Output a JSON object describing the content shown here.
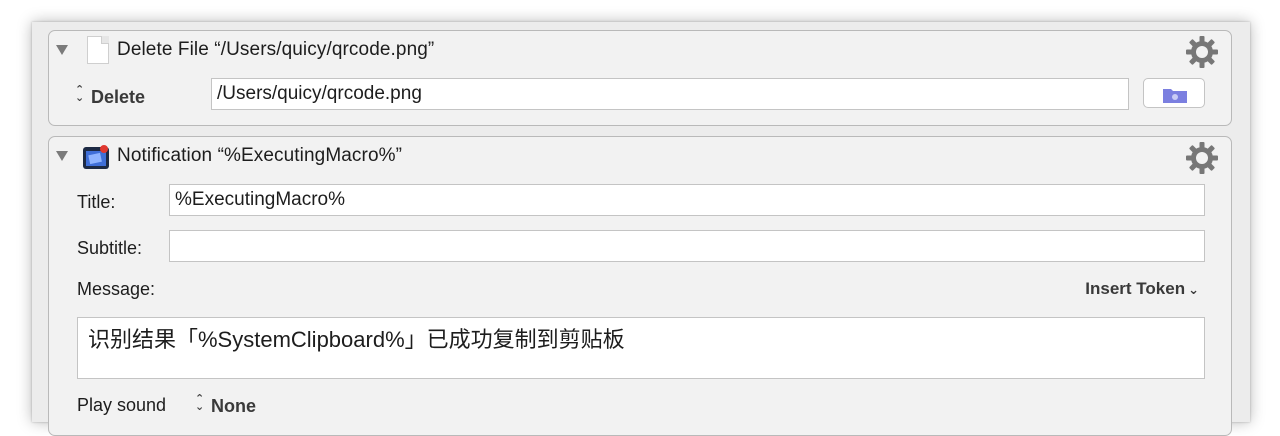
{
  "actions": [
    {
      "title": "Delete File “/Users/quicy/qrcode.png”",
      "icon": "file-icon",
      "operation_label": "Delete",
      "path_value": "/Users/quicy/qrcode.png",
      "folder_button_icon": "folder-icon"
    },
    {
      "title": "Notification “%ExecutingMacro%”",
      "icon": "notification-app-icon",
      "title_label": "Title:",
      "title_value": "%ExecutingMacro%",
      "subtitle_label": "Subtitle:",
      "subtitle_value": "",
      "message_label": "Message:",
      "insert_token_label": "Insert Token",
      "message_value": "识别结果「%SystemClipboard%」已成功复制到剪贴板",
      "play_sound_label": "Play sound",
      "sound_value": "None"
    }
  ],
  "colors": {
    "window_bg": "#ececec",
    "panel_bg": "#f2f2f2",
    "folder_icon": "#7b7fe0"
  }
}
